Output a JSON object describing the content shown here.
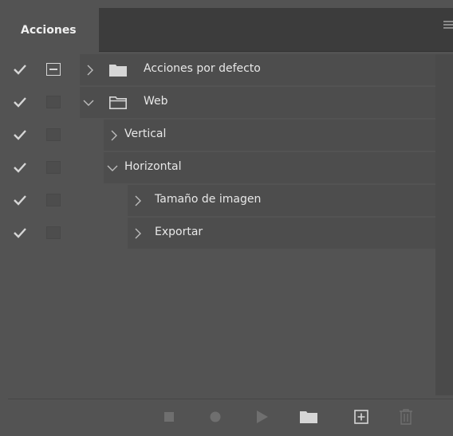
{
  "panel": {
    "tab_label": "Acciones"
  },
  "actions": [
    {
      "label": "Acciones por defecto",
      "checked": true,
      "dialog": true,
      "expanded": false,
      "type": "set",
      "open_folder": false
    },
    {
      "label": "Web",
      "checked": true,
      "dialog": false,
      "expanded": true,
      "type": "set",
      "open_folder": true
    },
    {
      "label": "Vertical",
      "checked": true,
      "dialog": false,
      "expanded": false,
      "type": "action"
    },
    {
      "label": "Horizontal",
      "checked": true,
      "dialog": false,
      "expanded": true,
      "type": "action"
    },
    {
      "label": "Tamaño de imagen",
      "checked": true,
      "dialog": false,
      "expanded": false,
      "type": "command"
    },
    {
      "label": "Exportar",
      "checked": true,
      "dialog": false,
      "expanded": false,
      "type": "command"
    }
  ],
  "footer_buttons": [
    {
      "name": "stop-button",
      "icon": "stop-icon"
    },
    {
      "name": "record-button",
      "icon": "record-icon"
    },
    {
      "name": "play-button",
      "icon": "play-icon"
    },
    {
      "name": "new-set-button",
      "icon": "folder-icon"
    },
    {
      "name": "new-action-button",
      "icon": "plus-square-icon"
    },
    {
      "name": "delete-button",
      "icon": "trash-icon"
    }
  ],
  "colors": {
    "panel_bg": "#535353",
    "row_bg": "#4d4d4d",
    "tabbar_bg": "#3c3c3c",
    "text": "#e8e8e8",
    "icon": "#d6d6d6"
  }
}
